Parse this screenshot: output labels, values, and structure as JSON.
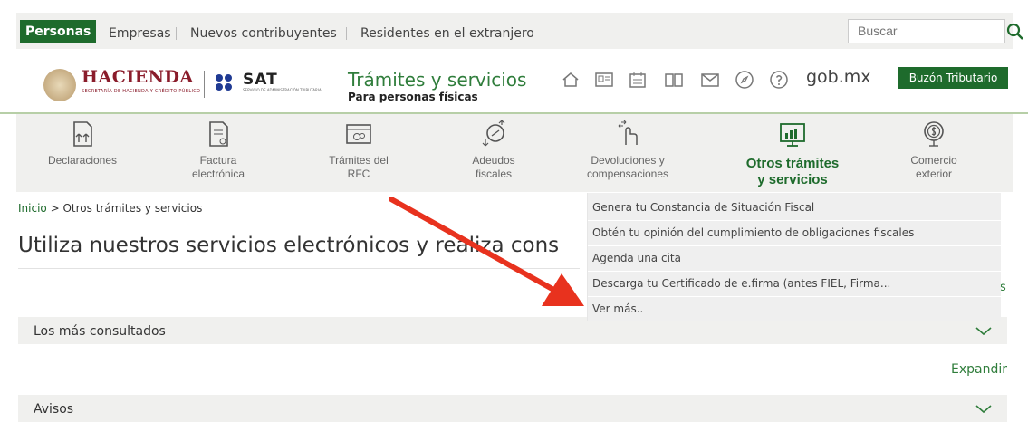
{
  "topbar": {
    "tabs": [
      "Personas",
      "Empresas",
      "Nuevos contribuyentes",
      "Residentes en el extranjero"
    ],
    "search_placeholder": "Buscar"
  },
  "brand": {
    "hacienda": "HACIENDA",
    "hacienda_sub": "SECRETARÍA DE HACIENDA Y CRÉDITO PÚBLICO",
    "sat": "SAT",
    "sat_sub": "SERVICIO DE ADMINISTRACIÓN TRIBUTARIA",
    "section_title": "Trámites y servicios",
    "section_sub": "Para personas físicas",
    "gobmx": "gob.mx",
    "buzon": "Buzón Tributario"
  },
  "nav": [
    {
      "label": "Declaraciones",
      "icon": "declaraciones-icon"
    },
    {
      "label": "Factura\nelectrónica",
      "icon": "factura-icon"
    },
    {
      "label": "Trámites del\nRFC",
      "icon": "rfc-icon"
    },
    {
      "label": "Adeudos\nfiscales",
      "icon": "adeudos-icon"
    },
    {
      "label": "Devoluciones y\ncompensaciones",
      "icon": "devoluciones-icon"
    },
    {
      "label": "Otros trámites\ny servicios",
      "icon": "otros-tramites-icon",
      "active": true
    },
    {
      "label": "Comercio\nexterior",
      "icon": "comercio-icon"
    }
  ],
  "dropdown": [
    "Genera tu Constancia de Situación Fiscal",
    "Obtén tu opinión del cumplimiento de obligaciones fiscales",
    "Agenda una cita",
    "Descarga tu Certificado de e.firma (antes FIEL, Firma...",
    "Ver más.."
  ],
  "breadcrumb": {
    "home": "Inicio",
    "sep": ">",
    "current": "Otros trámites y servicios"
  },
  "page_title": "Utiliza nuestros servicios electrónicos y realiza cons",
  "trailing_s": "s",
  "accordions": {
    "mas_consultados": "Los más consultados",
    "avisos": "Avisos"
  },
  "expandir": "Expandir",
  "colors": {
    "brand_green": "#1e6b2c",
    "accent_green": "#2f7d3b",
    "arrow_red": "#e8321e",
    "hacienda_red": "#8a1c2b"
  }
}
